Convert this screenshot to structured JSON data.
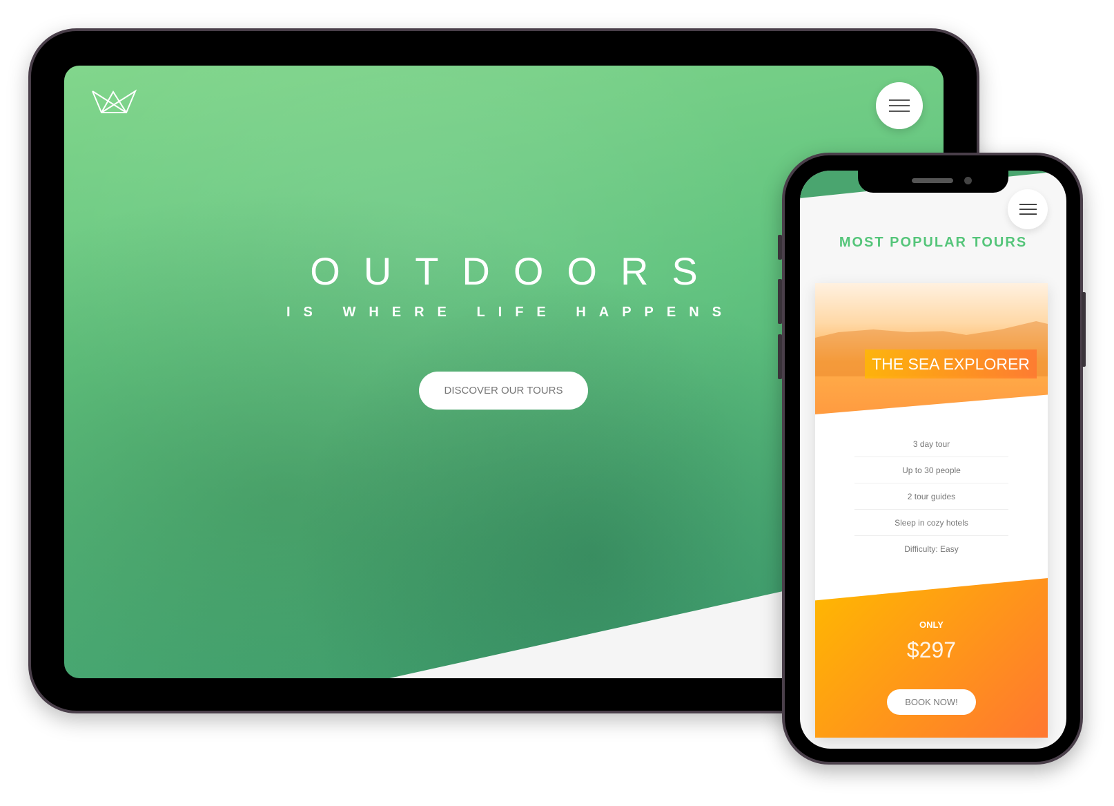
{
  "colors": {
    "primary_green": "#55c57a",
    "accent_orange": "#ff9b40",
    "orange_light": "#ffb900",
    "orange_dark": "#ff7730"
  },
  "tablet": {
    "logo_icon": "crown-outline-icon",
    "menu_icon": "hamburger-icon",
    "hero_title": "OUTDOORS",
    "hero_subtitle": "IS WHERE LIFE HAPPENS",
    "cta_label": "DISCOVER OUR TOURS"
  },
  "phone": {
    "menu_icon": "hamburger-icon",
    "section_title": "MOST POPULAR TOURS",
    "card": {
      "name": "THE SEA EXPLORER",
      "details": [
        "3 day tour",
        "Up to 30 people",
        "2 tour guides",
        "Sleep in cozy hotels",
        "Difficulty: Easy"
      ],
      "price_label": "ONLY",
      "price": "$297",
      "book_label": "BOOK NOW!"
    }
  }
}
